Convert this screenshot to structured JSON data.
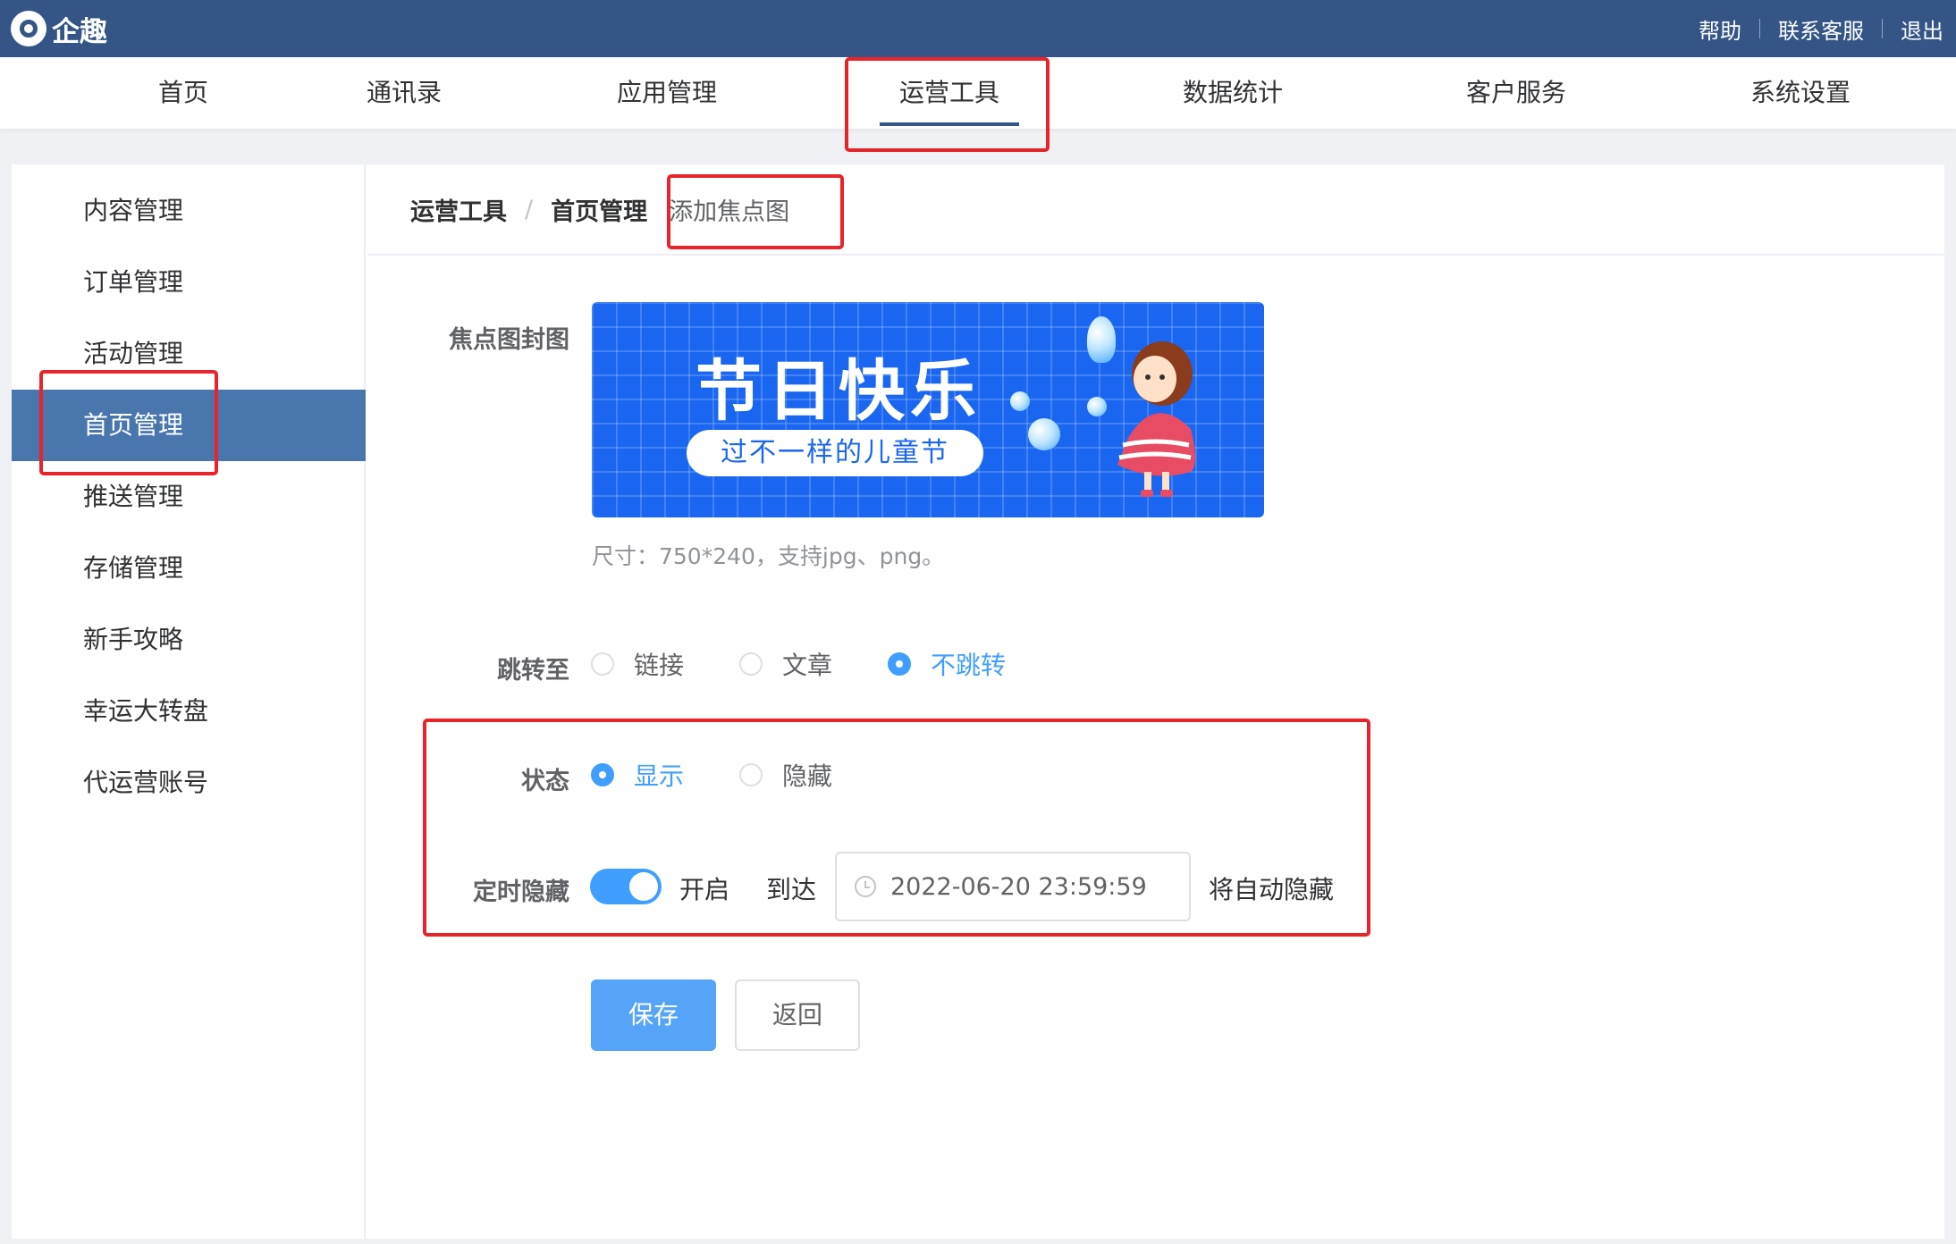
{
  "topbar": {
    "brand": "企趣",
    "links": [
      "帮助",
      "联系客服",
      "退出"
    ]
  },
  "nav": {
    "items": [
      "首页",
      "通讯录",
      "应用管理",
      "运营工具",
      "数据统计",
      "客户服务",
      "系统设置"
    ],
    "active_index": 3
  },
  "sidebar": {
    "items": [
      "内容管理",
      "订单管理",
      "活动管理",
      "首页管理",
      "推送管理",
      "存储管理",
      "新手攻略",
      "幸运大转盘",
      "代运营账号"
    ],
    "active_index": 3
  },
  "breadcrumb": {
    "level1": "运营工具",
    "separator": "/",
    "level2": "首页管理",
    "current": "添加焦点图"
  },
  "form": {
    "cover_label": "焦点图封图",
    "cover_title": "节日快乐",
    "cover_subtitle": "过不一样的儿童节",
    "cover_hint": "尺寸：750*240，支持jpg、png。",
    "jump_label": "跳转至",
    "jump_options": [
      "链接",
      "文章",
      "不跳转"
    ],
    "jump_selected": "不跳转",
    "status_label": "状态",
    "status_options": [
      "显示",
      "隐藏"
    ],
    "status_selected": "显示",
    "timed_hide_label": "定时隐藏",
    "timed_hide_enabled": true,
    "switch_text": "开启",
    "until_text": "到达",
    "datetime_value": "2022-06-20 23:59:59",
    "auto_hide_text": "将自动隐藏"
  },
  "buttons": {
    "save": "保存",
    "back": "返回"
  },
  "colors": {
    "header_bg": "#345585",
    "sidebar_active_bg": "#4a76ae",
    "primary": "#409eff",
    "highlight_box": "#e8242a"
  }
}
